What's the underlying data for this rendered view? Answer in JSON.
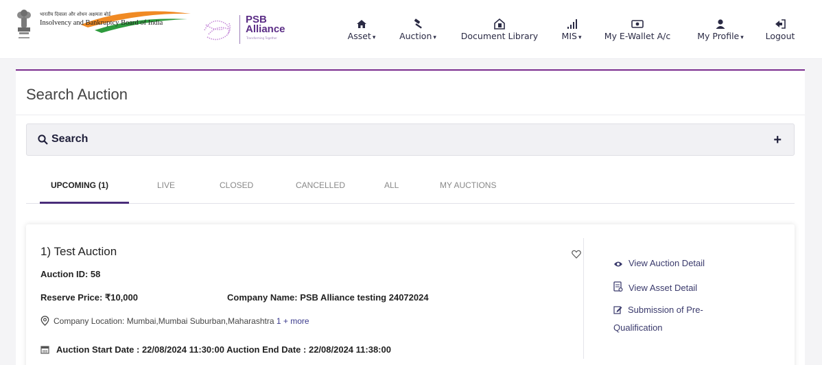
{
  "header": {
    "ibbi_hindi": "भारतीय दिवाला और शोधन अक्षमता बोर्ड",
    "ibbi_name": "Insolvency and Bankruptcy Board of India",
    "psb_line1": "PSB",
    "psb_line2": "Alliance",
    "psb_tagline": "Transforming Together",
    "nav": [
      {
        "label": "Asset",
        "icon": "home-icon",
        "dropdown": true
      },
      {
        "label": "Auction",
        "icon": "gavel-icon",
        "dropdown": true
      },
      {
        "label": "Document Library",
        "icon": "document-library-icon",
        "dropdown": false
      },
      {
        "label": "MIS",
        "icon": "signal-bars-icon",
        "dropdown": true
      },
      {
        "label": "My E-Wallet A/c",
        "icon": "wallet-icon",
        "dropdown": false
      },
      {
        "label": "My Profile",
        "icon": "user-icon",
        "dropdown": true
      },
      {
        "label": "Logout",
        "icon": "logout-icon",
        "dropdown": false
      }
    ]
  },
  "page": {
    "title": "Search Auction",
    "search_label": "Search",
    "expand_symbol": "+"
  },
  "tabs": [
    {
      "label": "UPCOMING (1)",
      "active": true
    },
    {
      "label": "LIVE",
      "active": false
    },
    {
      "label": "CLOSED",
      "active": false
    },
    {
      "label": "CANCELLED",
      "active": false
    },
    {
      "label": "ALL",
      "active": false
    },
    {
      "label": "MY AUCTIONS",
      "active": false
    }
  ],
  "auction": {
    "title": "1) Test Auction",
    "id_text": "Auction ID: 58",
    "reserve_text": "Reserve Price: ₹10,000",
    "company_text": "Company Name: PSB Alliance testing 24072024",
    "location_text": "Company Location: Mumbai,Mumbai Suburban,Maharashtra ",
    "location_more": "1 + more",
    "dates_text": "Auction Start Date : 22/08/2024 11:30:00   Auction End Date : 22/08/2024 11:38:00",
    "actions": {
      "view_auction": "View Auction Detail",
      "view_asset": "View Asset Detail",
      "prequal_line1": "Submission of Pre-",
      "prequal_line2": "Qualification"
    }
  },
  "colors": {
    "brand_purple": "#5b2d86",
    "accent_border": "#7a2b8e",
    "tab_underline": "#4a2d7a",
    "nav_text": "#2a2a44"
  }
}
